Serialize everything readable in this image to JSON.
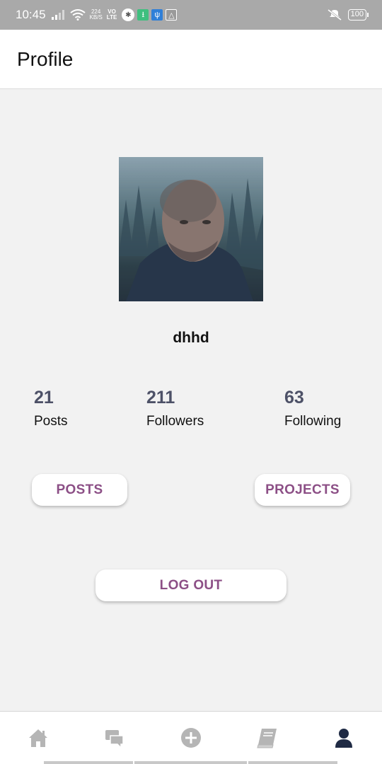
{
  "status_bar": {
    "time": "10:45",
    "speed_value": "224",
    "speed_unit": "KB/S",
    "network_top": "VO",
    "network_bottom": "LTE",
    "battery": "100",
    "icons": [
      "signal-icon",
      "wifi-icon",
      "bluetooth-icon",
      "download-icon",
      "usb-icon",
      "drive-icon",
      "mute-icon",
      "battery-icon"
    ]
  },
  "header": {
    "title": "Profile"
  },
  "profile": {
    "username": "dhhd",
    "stats": [
      {
        "count": "21",
        "label": "Posts"
      },
      {
        "count": "211",
        "label": "Followers"
      },
      {
        "count": "63",
        "label": "Following"
      }
    ]
  },
  "actions": {
    "posts_label": "POSTS",
    "projects_label": "PROJECTS",
    "logout_label": "LOG OUT"
  },
  "bottom_nav": {
    "items": [
      {
        "icon": "home-icon",
        "active": false
      },
      {
        "icon": "chat-icon",
        "active": false
      },
      {
        "icon": "add-icon",
        "active": false
      },
      {
        "icon": "book-icon",
        "active": false
      },
      {
        "icon": "profile-icon",
        "active": true
      }
    ]
  },
  "colors": {
    "accent": "#8c4f86",
    "stat_count": "#4d5167",
    "background": "#f2f2f2",
    "status_bar": "#a9a9a9",
    "nav_inactive": "#b5b5b5",
    "nav_active": "#1f2a44"
  }
}
